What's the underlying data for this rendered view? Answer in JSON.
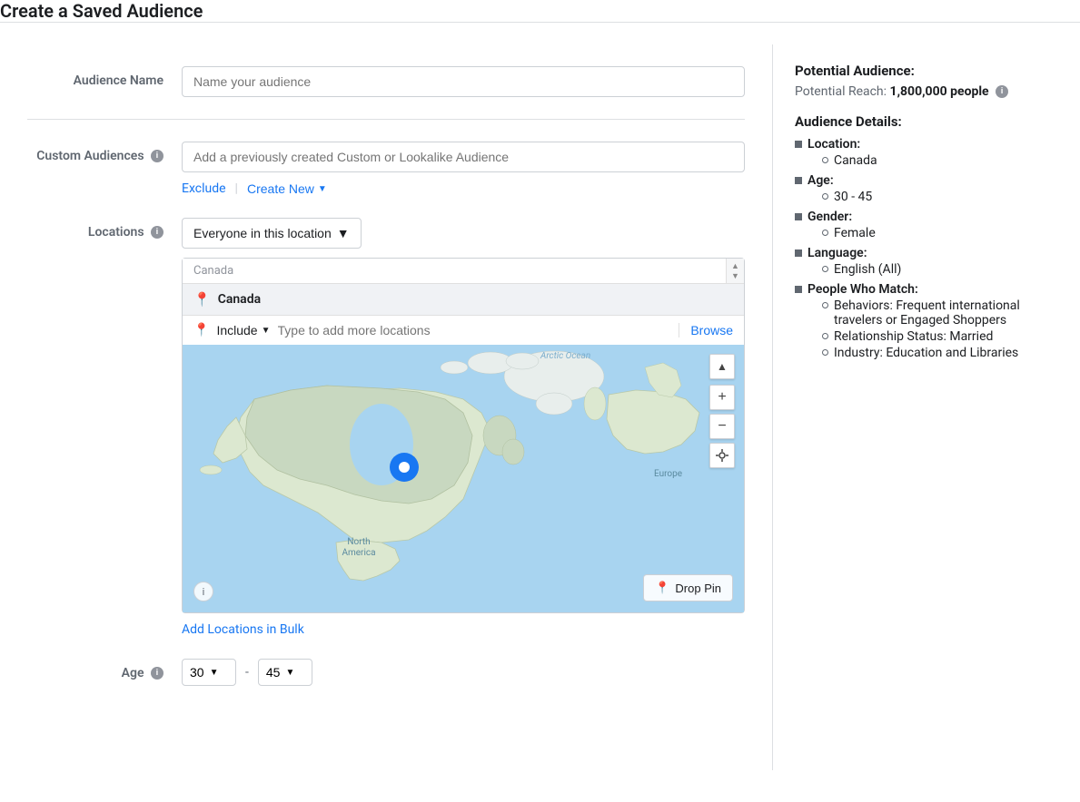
{
  "page": {
    "title": "Create a Saved Audience"
  },
  "form": {
    "audience_name_label": "Audience Name",
    "audience_name_placeholder": "Name your audience",
    "custom_audiences_label": "Custom Audiences",
    "custom_audiences_info": "i",
    "custom_audiences_placeholder": "Add a previously created Custom or Lookalike Audience",
    "exclude_label": "Exclude",
    "create_new_label": "Create New",
    "locations_label": "Locations",
    "locations_info": "i",
    "everyone_in_location": "Everyone in this location",
    "location_country_header": "Canada",
    "location_country_name": "Canada",
    "include_label": "Include",
    "location_type_placeholder": "Type to add more locations",
    "browse_label": "Browse",
    "add_locations_bulk": "Add Locations in Bulk",
    "age_label": "Age",
    "age_info": "i",
    "age_from": "30",
    "age_to": "45",
    "age_separator": "-",
    "map_arctic_label": "Arctic Ocean",
    "map_na_label": "North\nAmerica",
    "map_europe_label": "Europe",
    "drop_pin_label": "Drop Pin"
  },
  "sidebar": {
    "potential_title": "Potential Audience:",
    "potential_reach_label": "Potential Reach:",
    "potential_reach_value": "1,800,000 people",
    "details_title": "Audience Details:",
    "details": [
      {
        "key": "Location:",
        "children": [
          "Canada"
        ]
      },
      {
        "key": "Age:",
        "children": [
          "30 - 45"
        ]
      },
      {
        "key": "Gender:",
        "children": [
          "Female"
        ]
      },
      {
        "key": "Language:",
        "children": [
          "English (All)"
        ]
      },
      {
        "key": "People Who Match:",
        "children": [
          "Behaviors: Frequent international travelers or Engaged Shoppers",
          "Relationship Status: Married",
          "Industry: Education and Libraries"
        ]
      }
    ]
  }
}
